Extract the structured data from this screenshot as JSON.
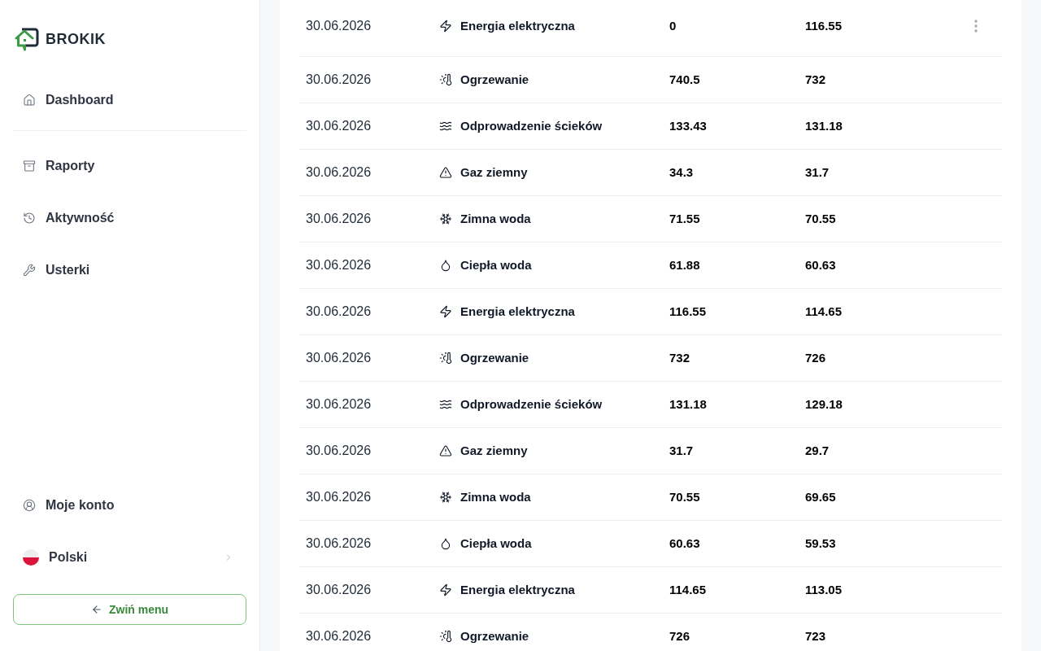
{
  "sidebar": {
    "brand": "BROKIK",
    "nav_sections": [
      {
        "items": [
          {
            "label": "Dashboard",
            "selected": false
          }
        ]
      },
      {
        "items": [
          {
            "label": "Raporty",
            "selected": false
          },
          {
            "label": "Aktywność",
            "selected": false
          },
          {
            "label": "Usterki",
            "selected": false
          }
        ]
      }
    ],
    "account": {
      "label": "Moje konto"
    },
    "language": {
      "label": "Polski"
    },
    "collapse_button": {
      "label": "Zwiń menu"
    }
  },
  "table": {
    "rows": [
      {
        "date": "30.06.2026",
        "kind": "electricity",
        "type": "Energia elektryczna",
        "column_3": "0",
        "column_4": "116.55",
        "menu": true
      },
      {
        "date": "30.06.2026",
        "kind": "heating",
        "type": "Ogrzewanie",
        "column_3": "740.5",
        "column_4": "732",
        "menu": false
      },
      {
        "date": "30.06.2026",
        "kind": "sewage",
        "type": "Odprowadzenie ścieków",
        "column_3": "133.43",
        "column_4": "131.18",
        "menu": false
      },
      {
        "date": "30.06.2026",
        "kind": "gas",
        "type": "Gaz ziemny",
        "column_3": "34.3",
        "column_4": "31.7",
        "menu": false
      },
      {
        "date": "30.06.2026",
        "kind": "cold_water",
        "type": "Zimna woda",
        "column_3": "71.55",
        "column_4": "70.55",
        "menu": false
      },
      {
        "date": "30.06.2026",
        "kind": "hot_water",
        "type": "Ciepła woda",
        "column_3": "61.88",
        "column_4": "60.63",
        "menu": false
      },
      {
        "date": "30.06.2026",
        "kind": "electricity",
        "type": "Energia elektryczna",
        "column_3": "116.55",
        "column_4": "114.65",
        "menu": false
      },
      {
        "date": "30.06.2026",
        "kind": "heating",
        "type": "Ogrzewanie",
        "column_3": "732",
        "column_4": "726",
        "menu": false
      },
      {
        "date": "30.06.2026",
        "kind": "sewage",
        "type": "Odprowadzenie ścieków",
        "column_3": "131.18",
        "column_4": "129.18",
        "menu": false
      },
      {
        "date": "30.06.2026",
        "kind": "gas",
        "type": "Gaz ziemny",
        "column_3": "31.7",
        "column_4": "29.7",
        "menu": false
      },
      {
        "date": "30.06.2026",
        "kind": "cold_water",
        "type": "Zimna woda",
        "column_3": "70.55",
        "column_4": "69.65",
        "menu": false
      },
      {
        "date": "30.06.2026",
        "kind": "hot_water",
        "type": "Ciepła woda",
        "column_3": "60.63",
        "column_4": "59.53",
        "menu": false
      },
      {
        "date": "30.06.2026",
        "kind": "electricity",
        "type": "Energia elektryczna",
        "column_3": "114.65",
        "column_4": "113.05",
        "menu": false
      },
      {
        "date": "30.06.2026",
        "kind": "heating",
        "type": "Ogrzewanie",
        "column_3": "726",
        "column_4": "723",
        "menu": false
      }
    ]
  }
}
